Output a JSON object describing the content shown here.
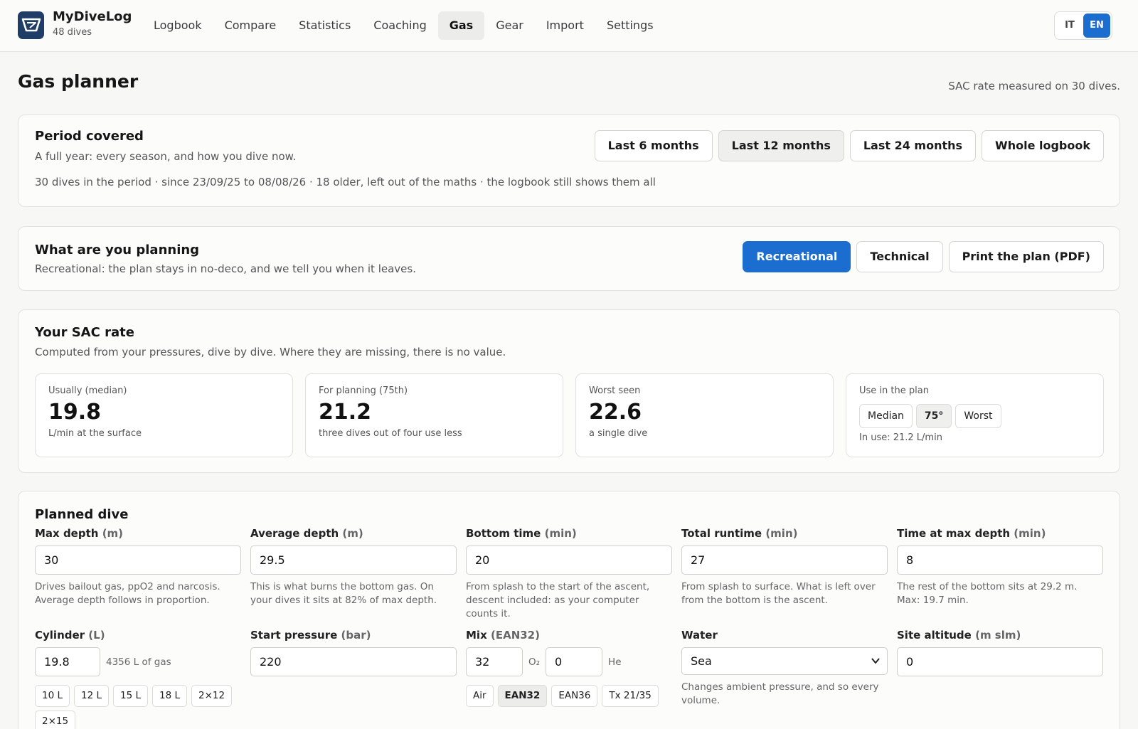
{
  "app": {
    "name": "MyDiveLog",
    "dive_count": "48 dives"
  },
  "nav": {
    "items": [
      "Logbook",
      "Compare",
      "Statistics",
      "Coaching",
      "Gas",
      "Gear",
      "Import",
      "Settings"
    ],
    "active": "Gas"
  },
  "lang": {
    "it": "IT",
    "en": "EN",
    "active": "EN"
  },
  "page": {
    "title": "Gas planner",
    "note": "SAC rate measured on 30 dives."
  },
  "period": {
    "title": "Period covered",
    "subtitle": "A full year: every season, and how you dive now.",
    "buttons": [
      "Last 6 months",
      "Last 12 months",
      "Last 24 months",
      "Whole logbook"
    ],
    "selected": "Last 12 months",
    "summary": "30 dives in the period · since 23/09/25 to 08/08/26 · 18 older, left out of the maths · the logbook still shows them all"
  },
  "planning": {
    "title": "What are you planning",
    "subtitle": "Recreational: the plan stays in no-deco, and we tell you when it leaves.",
    "recreational": "Recreational",
    "technical": "Technical",
    "print": "Print the plan (PDF)"
  },
  "sac": {
    "title": "Your SAC rate",
    "subtitle": "Computed from your pressures, dive by dive. Where they are missing, there is no value.",
    "median": {
      "label": "Usually (median)",
      "value": "19.8",
      "note": "L/min at the surface"
    },
    "p75": {
      "label": "For planning (75th)",
      "value": "21.2",
      "note": "three dives out of four use less"
    },
    "worst": {
      "label": "Worst seen",
      "value": "22.6",
      "note": "a single dive"
    },
    "use": {
      "label": "Use in the plan",
      "options": [
        "Median",
        "75°",
        "Worst"
      ],
      "selected": "75°",
      "in_use": "In use: 21.2 L/min"
    }
  },
  "planned": {
    "title": "Planned dive",
    "max_depth": {
      "label": "Max depth",
      "unit": "(m)",
      "value": "30",
      "hint": "Drives bailout gas, ppO2 and narcosis. Average depth follows in proportion."
    },
    "avg_depth": {
      "label": "Average depth",
      "unit": "(m)",
      "value": "29.5",
      "hint": "This is what burns the bottom gas. On your dives it sits at 82% of max depth."
    },
    "bottom_time": {
      "label": "Bottom time",
      "unit": "(min)",
      "value": "20",
      "hint": "From splash to the start of the ascent, descent included: as your computer counts it."
    },
    "runtime": {
      "label": "Total runtime",
      "unit": "(min)",
      "value": "27",
      "hint": "From splash to surface. What is left over from the bottom is the ascent."
    },
    "time_max": {
      "label": "Time at max depth",
      "unit": "(min)",
      "value": "8",
      "hint": "The rest of the bottom sits at 29.2 m. Max: 19.7 min."
    },
    "cylinder": {
      "label": "Cylinder",
      "unit": "(L)",
      "value": "19.8",
      "gas_note": "4356 L of gas",
      "presets": [
        "10 L",
        "12 L",
        "15 L",
        "18 L",
        "2×12",
        "2×15"
      ]
    },
    "start_pressure": {
      "label": "Start pressure",
      "unit": "(bar)",
      "value": "220"
    },
    "mix": {
      "label": "Mix",
      "unit": "(EAN32)",
      "o2": "32",
      "o2_label": "O₂",
      "he": "0",
      "he_label": "He",
      "presets": [
        "Air",
        "EAN32",
        "EAN36",
        "Tx 21/35"
      ],
      "selected": "EAN32"
    },
    "water": {
      "label": "Water",
      "value": "Sea",
      "hint": "Changes ambient pressure, and so every volume."
    },
    "altitude": {
      "label": "Site altitude",
      "unit": "(m slm)",
      "value": "0"
    }
  },
  "colors": {
    "accent": "#1c6dd0",
    "logo": "#1f3d66"
  }
}
